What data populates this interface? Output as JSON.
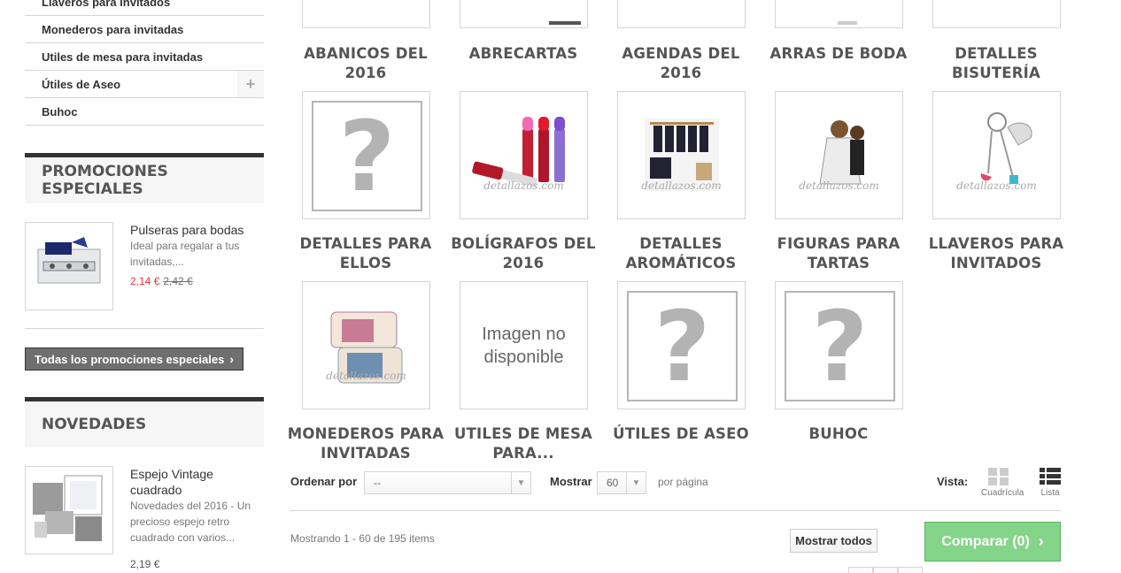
{
  "sidebar": {
    "categories": [
      {
        "label": "Llaveros para invitados"
      },
      {
        "label": "Monederos para invitadas"
      },
      {
        "label": "Utiles de mesa para invitadas"
      },
      {
        "label": "Útiles de Aseo",
        "expand": "+"
      },
      {
        "label": "Buhoc"
      }
    ],
    "promotions": {
      "title": "PROMOCIONES ESPECIALES",
      "product": {
        "name": "Pulseras para bodas",
        "description": "Ideal para regalar a tus invitadas,...",
        "price": "2,14 €",
        "old_price": "2,42 €"
      },
      "all_button": "Todas los promociones especiales",
      "chevron": "›"
    },
    "novedades": {
      "title": "NOVEDADES",
      "product": {
        "name": "Espejo Vintage cuadrado",
        "description": "Novedades del 2016 - Un precioso espejo retro cuadrado con varios...",
        "price": "2,19 €"
      }
    }
  },
  "grid": {
    "top_row": [
      "ABANICOS DEL 2016",
      "ABRECARTAS",
      "AGENDAS DEL 2016",
      "ARRAS DE BODA",
      "DETALLES BISUTERÍA"
    ],
    "middle_row": [
      "DETALLES PARA ELLOS",
      "BOLÍGRAFOS DEL 2016",
      "DETALLES AROMÁTICOS",
      "FIGURAS PARA TARTAS",
      "LLAVEROS PARA INVITADOS"
    ],
    "bottom_row": [
      "MONEDEROS PARA INVITADAS",
      "UTILES DE MESA PARA...",
      "ÚTILES DE ASEO",
      "BUHOC"
    ],
    "placeholder_glyph": "?",
    "no_image_text": "Imagen no disponible",
    "watermark": "detallazos.com"
  },
  "toolbar": {
    "sort_label": "Ordenar por",
    "sort_value": "--",
    "show_label": "Mostrar",
    "show_value": "60",
    "per_page": "por página",
    "view_label": "Vista:",
    "view_grid": "Cuadrícula",
    "view_list": "Lista",
    "showing": "Mostrando 1 - 60 de 195 items",
    "show_all": "Mostrar todos",
    "compare": "Comparar (0)",
    "compare_chevron": "›"
  },
  "colors": {
    "compare_bg": "#84d48a",
    "price_new": "#f13340",
    "block_border": "#333333"
  }
}
